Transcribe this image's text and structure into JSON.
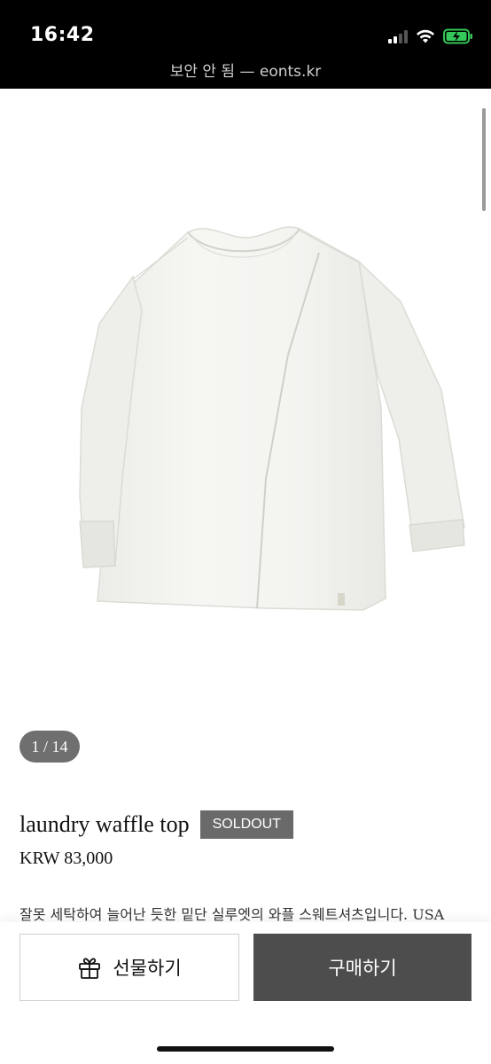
{
  "status_bar": {
    "time": "16:42"
  },
  "browser": {
    "url_text": "보안 안 됨 — eonts.kr"
  },
  "gallery": {
    "pager_text": "1 / 14"
  },
  "product": {
    "title": "laundry waffle top",
    "badge": "SOLDOUT",
    "price": "KRW 83,000",
    "description": "잘못 세탁하여 늘어난 듯한 밑단 실루엣의 와플 스웨트셔츠입니다. USA"
  },
  "actions": {
    "gift_label": "선물하기",
    "buy_label": "구매하기"
  },
  "icons": {
    "gift": "gift-icon",
    "wifi": "wifi-icon",
    "battery": "battery-charging-icon",
    "signal": "signal-icon"
  },
  "colors": {
    "battery_green": "#34c759",
    "badge_bg": "#6a6a6a",
    "buy_bg": "#4d4d4d"
  }
}
